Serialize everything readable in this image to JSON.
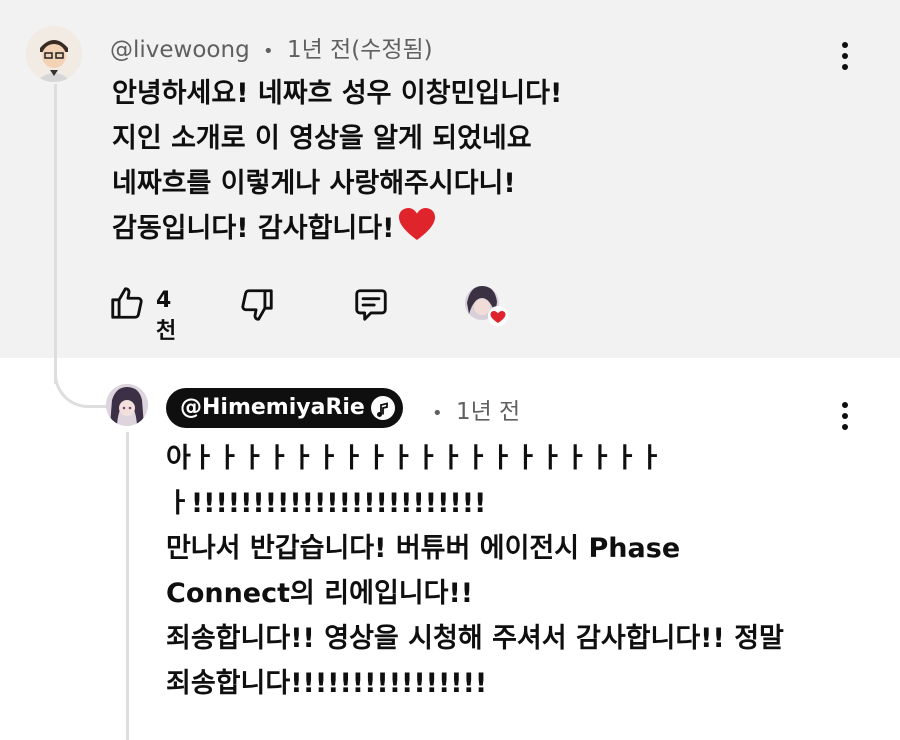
{
  "main_comment": {
    "author": "@livewoong",
    "separator": "•",
    "time": "1년 전(수정됨)",
    "lines": [
      "안녕하세요! 네짜흐 성우 이창민입니다!",
      "지인 소개로 이 영상을 알게 되었네요",
      "네짜흐를 이렇게나 사랑해주시다니!",
      "감동입니다! 감사합니다!"
    ],
    "line4_emoji": "heart-emoji",
    "like_count": "4천",
    "icons": {
      "like": "thumbs-up-icon",
      "dislike": "thumbs-down-icon",
      "reply": "reply-icon",
      "creator_heart": "creator-heart-avatar",
      "menu": "more-vert-icon"
    }
  },
  "reply_comment": {
    "author": "@HimemiyaRie",
    "separator": "•",
    "time": "1년 전",
    "lines": [
      "아ㅏㅏㅏㅏㅏㅏㅏㅏㅏㅏㅏㅏㅏㅏㅏㅏㅏㅏㅏ",
      "ㅏ!!!!!!!!!!!!!!!!!!!!!!!!",
      "만나서 반갑습니다! 버튜버 에이전시 Phase",
      "Connect의 리에입니다!!",
      "죄송합니다!! 영상을 시청해 주셔서 감사합니다!! 정말",
      "죄송합니다!!!!!!!!!!!!!!!!"
    ],
    "icons": {
      "badge": "music-note-badge-icon",
      "menu": "more-vert-icon"
    }
  },
  "colors": {
    "top_bg": "#f2f2f2",
    "text": "#0f0f0f",
    "meta": "#606060",
    "heart": "#e0242c"
  }
}
